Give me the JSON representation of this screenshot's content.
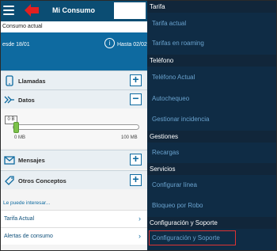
{
  "app": {
    "title": "Mi Consumo",
    "consumo_label": "Consumo actual",
    "period": {
      "desde": "esde 18/01",
      "hasta": "Hasta 02/02"
    },
    "info_glyph": "i",
    "rows": {
      "llamadas": "Llamadas",
      "datos": "Datos",
      "mensajes": "Mensajes",
      "otros": "Otros Conceptos"
    },
    "datos_slider": {
      "value_label": "0 B",
      "min_label": "0 MB",
      "max_label": "100 MB",
      "fill_fraction": 0.0
    },
    "interest_heading": "Le puede interesar...",
    "links": [
      {
        "label": "Tarifa Actual"
      },
      {
        "label": "Alertas de consumo"
      }
    ]
  },
  "menu": {
    "sections": {
      "tarifa": "Tarifa",
      "telefono": "Teléfono",
      "gestiones": "Gestiones",
      "servicios": "Servicios",
      "config": "Configuración y Soporte"
    },
    "items": {
      "tarifa_actual": "Tarifa actual",
      "tarifas_roaming": "Tarifas en roaming",
      "telefono_actual": "Teléfono Actual",
      "autochequeo": "Autochequeo",
      "gestionar_incidencia": "Gestionar incidencia",
      "recargas": "Recargas",
      "configurar_linea": "Configurar línea",
      "bloqueo_robo": "Bloqueo por Robo",
      "config_soporte": "Configuración y Soporte"
    }
  },
  "colors": {
    "appbar": "#0b4d73",
    "accent": "#0e6aa0",
    "menu_bg": "#0f2c45",
    "menu_link": "#6aa3cf",
    "highlight": "#dd3333",
    "slider_fill": "#9ad66a"
  },
  "icons": [
    "hamburger-icon",
    "red-arrow-icon",
    "info-icon",
    "phone-icon",
    "data-arrows-icon",
    "envelope-icon",
    "tag-icon",
    "plus-icon",
    "minus-icon",
    "chevron-right-icon"
  ]
}
